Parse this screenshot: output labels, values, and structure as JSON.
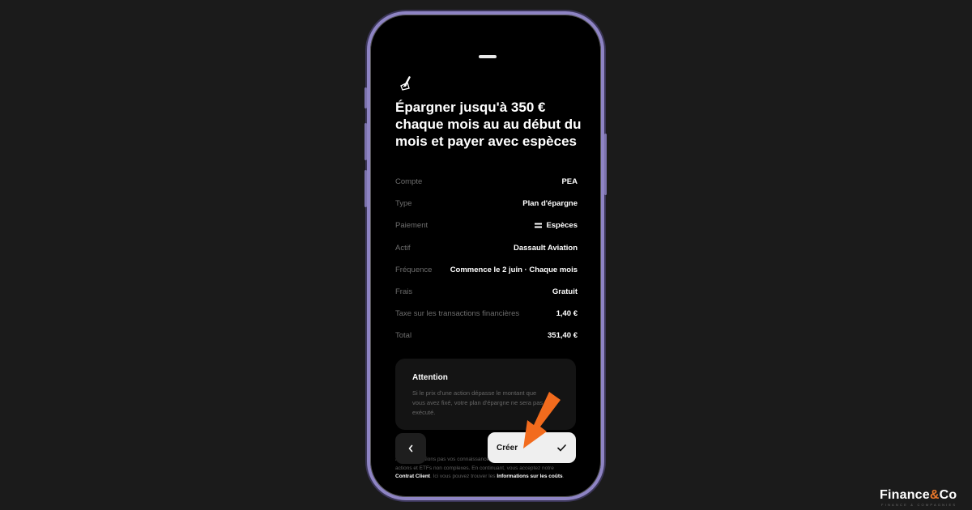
{
  "plan": {
    "title": "Épargner jusqu'à 350 € chaque mois au au début du mois et payer avec espèces",
    "rows": [
      {
        "label": "Compte",
        "value": "PEA"
      },
      {
        "label": "Type",
        "value": "Plan d'épargne"
      },
      {
        "label": "Paiement",
        "value": "Espèces",
        "icon": "cash-icon"
      },
      {
        "label": "Actif",
        "value": "Dassault Aviation"
      },
      {
        "label": "Fréquence",
        "value": "Commence le 2 juin · Chaque mois"
      },
      {
        "label": "Frais",
        "value": "Gratuit"
      },
      {
        "label": "Taxe sur les transactions financières",
        "value": "1,40 €"
      },
      {
        "label": "Total",
        "value": "351,40 €"
      }
    ]
  },
  "attention": {
    "title": "Attention",
    "text": "Si le prix d'une action dépasse le montant que vous avez fixé, votre plan d'épargne ne sera pas exécuté."
  },
  "legal": {
    "part1": "Nous ne vérifions pas vos connaissances en matière d'investissement en actions et ETFs non complexes. En continuant, vous acceptez notre ",
    "link1": "Contrat Client",
    "part2": ". Ici vous pouvez trouver les ",
    "link2": "Informations sur les coûts",
    "part3": "."
  },
  "buttons": {
    "back_icon": "chevron-left-icon",
    "create_label": "Créer",
    "create_icon": "checkmark-icon"
  },
  "brand": {
    "name_left": "Finance",
    "name_amp": "&",
    "name_right": "Co",
    "tagline": "FINANCE & COMPAGNIES",
    "accent": "#e8772a"
  },
  "colors": {
    "phone_frame": "#8e84c4",
    "arrow": "#f26b1d",
    "background": "#1b1b1b"
  }
}
